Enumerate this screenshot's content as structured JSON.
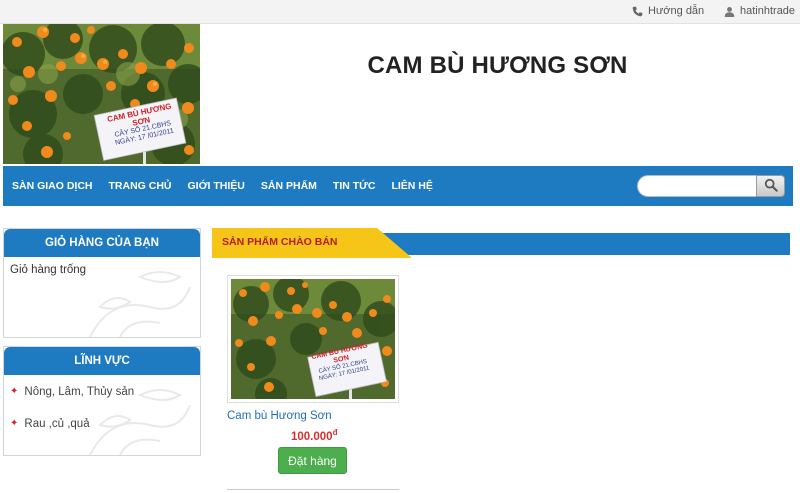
{
  "topbar": {
    "help_label": "Hướng dẫn",
    "user_label": "hatinhtrade"
  },
  "header": {
    "title": "CAM BÙ HƯƠNG SƠN",
    "image": {
      "sign_line1": "CAM BÙ HƯƠNG SƠN",
      "sign_line2": "CÂY SỐ  21.CBHS",
      "sign_line3": "NGÀY: 17 /01/2011"
    }
  },
  "nav": {
    "items": [
      {
        "label": "SÀN GIAO DỊCH"
      },
      {
        "label": "TRANG CHỦ"
      },
      {
        "label": "GIỚI THIỆU"
      },
      {
        "label": "SẢN PHẨM"
      },
      {
        "label": "TIN TỨC"
      },
      {
        "label": "LIÊN HỆ"
      }
    ],
    "search": {
      "placeholder": "",
      "value": ""
    }
  },
  "sidebar": {
    "cart": {
      "title": "GIỎ HÀNG CỦA BẠN",
      "empty_text": "Giỏ hàng trống"
    },
    "fields": {
      "title": "LĨNH VỰC",
      "items": [
        {
          "label": "Nông, Lâm, Thủy sản"
        },
        {
          "label": "Rau ,củ ,quả"
        }
      ]
    }
  },
  "main": {
    "section_title": "SẢN PHẨM CHÀO BÁN",
    "products": [
      {
        "name": "Cam bù Hương Sơn",
        "price": "100.000",
        "currency": "đ",
        "order_label": "Đặt hàng"
      }
    ]
  },
  "colors": {
    "primary_blue": "#1e7bc2",
    "accent_yellow": "#f5c518",
    "price_red": "#d32f2f",
    "order_green": "#4cae4c"
  },
  "icons": {
    "help": "phone-icon",
    "user": "user-icon",
    "search": "search-icon",
    "list_bullet": "star-bullet-icon"
  }
}
